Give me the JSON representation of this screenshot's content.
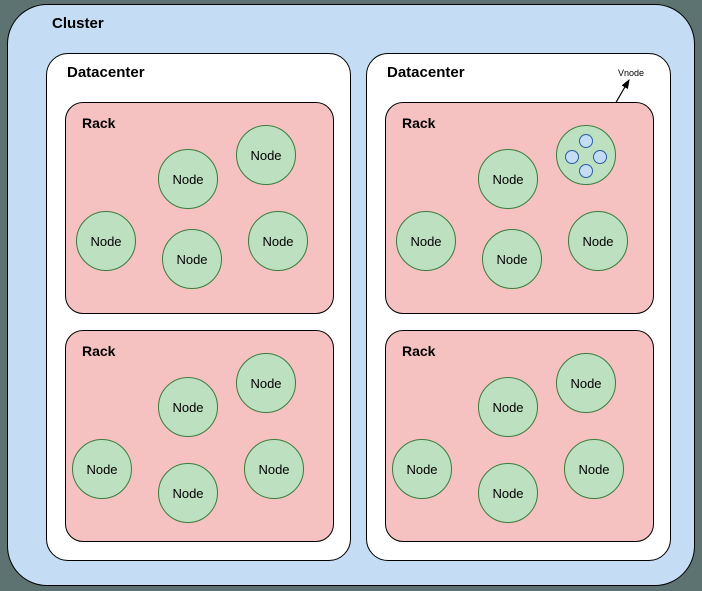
{
  "cluster": {
    "label": "Cluster"
  },
  "datacenters": [
    {
      "label": "Datacenter",
      "racks": [
        {
          "label": "Rack",
          "nodes": [
            "Node",
            "Node",
            "Node",
            "Node",
            "Node"
          ],
          "hasVnodeCell": false
        },
        {
          "label": "Rack",
          "nodes": [
            "Node",
            "Node",
            "Node",
            "Node",
            "Node"
          ],
          "hasVnodeCell": false
        }
      ]
    },
    {
      "label": "Datacenter",
      "vnodeLabel": "Vnode",
      "racks": [
        {
          "label": "Rack",
          "nodes": [
            "Node",
            "Node",
            "Node",
            "Node"
          ],
          "hasVnodeCell": true,
          "vnodeCount": 4
        },
        {
          "label": "Rack",
          "nodes": [
            "Node",
            "Node",
            "Node",
            "Node",
            "Node"
          ],
          "hasVnodeCell": false
        }
      ]
    }
  ],
  "colors": {
    "background": "#5d7371",
    "cluster": "#c4dcf4",
    "datacenter": "#ffffff",
    "rack": "#f5c1c1",
    "node": "#bde0c1",
    "vnode": "#c4dcf4"
  }
}
